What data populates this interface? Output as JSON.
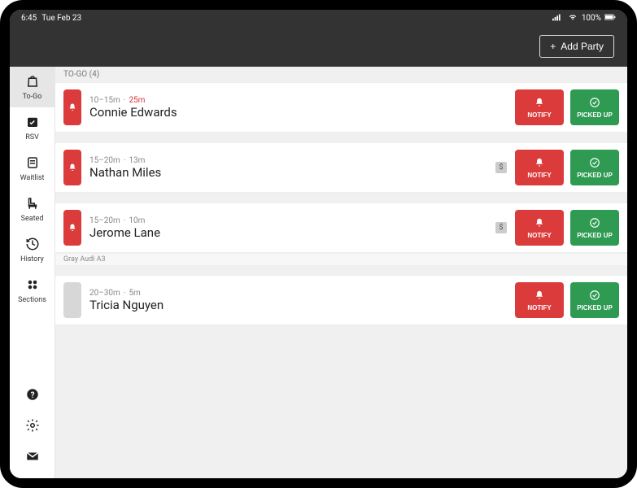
{
  "status_bar": {
    "time": "6:45",
    "date": "Tue Feb 23",
    "battery_text": "100%"
  },
  "top_bar": {
    "add_party_label": "Add Party"
  },
  "sidebar": {
    "items": [
      {
        "id": "togo",
        "label": "To-Go",
        "active": true
      },
      {
        "id": "rsv",
        "label": "RSV",
        "active": false
      },
      {
        "id": "waitlist",
        "label": "Waitlist",
        "active": false
      },
      {
        "id": "seated",
        "label": "Seated",
        "active": false
      },
      {
        "id": "history",
        "label": "History",
        "active": false
      },
      {
        "id": "sections",
        "label": "Sections",
        "active": false
      }
    ]
  },
  "section_header": "TO-GO (4)",
  "orders": [
    {
      "name": "Connie Edwards",
      "wait_window": "10–15m",
      "elapsed": "25m",
      "overdue": true,
      "pill_color": "red",
      "show_bell_pill": true,
      "money_flag": false,
      "sub_label": null,
      "notify_label": "NOTIFY",
      "pickup_label": "PICKED UP"
    },
    {
      "name": "Nathan Miles",
      "wait_window": "15–20m",
      "elapsed": "13m",
      "overdue": false,
      "pill_color": "red",
      "show_bell_pill": true,
      "money_flag": true,
      "sub_label": null,
      "notify_label": "NOTIFY",
      "pickup_label": "PICKED UP"
    },
    {
      "name": "Jerome Lane",
      "wait_window": "15–20m",
      "elapsed": "10m",
      "overdue": false,
      "pill_color": "red",
      "show_bell_pill": true,
      "money_flag": true,
      "sub_label": "Gray Audi A3",
      "notify_label": "NOTIFY",
      "pickup_label": "PICKED UP"
    },
    {
      "name": "Tricia Nguyen",
      "wait_window": "20–30m",
      "elapsed": "5m",
      "overdue": false,
      "pill_color": "gray",
      "show_bell_pill": false,
      "money_flag": false,
      "sub_label": null,
      "notify_label": "NOTIFY",
      "pickup_label": "PICKED UP"
    }
  ]
}
